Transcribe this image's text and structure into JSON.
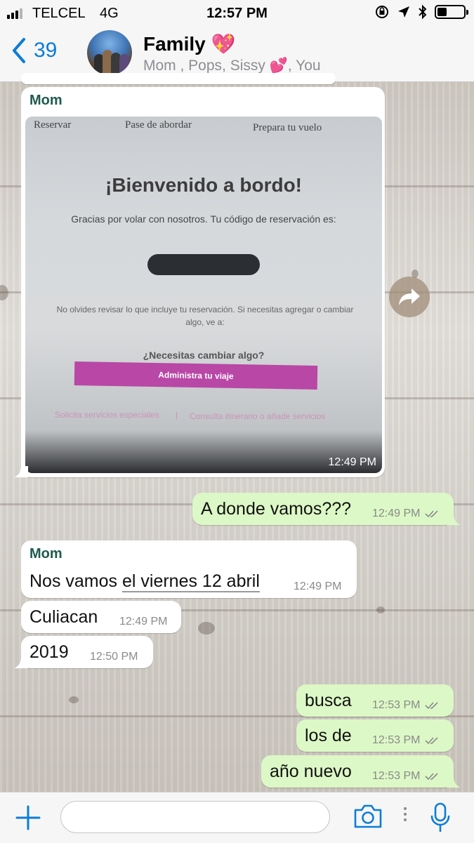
{
  "status_bar": {
    "carrier": "TELCEL",
    "network": "4G",
    "time": "12:57 PM",
    "battery_level": 0.35,
    "icons": [
      "orientation-lock-icon",
      "location-icon",
      "bluetooth-icon",
      "battery-icon"
    ]
  },
  "header": {
    "back_count": "39",
    "title": "Family 💖",
    "subtitle": "Mom , Pops, Sissy 💕, You"
  },
  "messages": {
    "image_msg": {
      "sender": "Mom",
      "time": "12:49 PM",
      "photo": {
        "nav": [
          "Reservar",
          "Pase de abordar",
          "Prepara tu vuelo"
        ],
        "welcome": "¡Bienvenido a bordo!",
        "thanks": "Gracias por volar con nosotros. Tu código de reservación es:",
        "note": "No olvides revisar lo que incluye tu reservación. Si necesitas agregar o cambiar algo, ve a:",
        "need": "¿Necesitas cambiar algo?",
        "cta": "Administra tu viaje",
        "link1": "Solicita servicios especiales",
        "separator": "|",
        "link2": "Consulta itinerario o añade servicios"
      }
    },
    "out1": {
      "text": "A donde vamos???",
      "time": "12:49 PM"
    },
    "mom2": {
      "sender": "Mom",
      "text_pre": "Nos vamos ",
      "text_link": "el viernes 12 abril",
      "time": "12:49 PM"
    },
    "mom3": {
      "text": "Culiacan",
      "time": "12:49 PM"
    },
    "mom4": {
      "text": "2019",
      "time": "12:50 PM"
    },
    "out2": {
      "text": "busca",
      "time": "12:53 PM"
    },
    "out3": {
      "text": "los de",
      "time": "12:53 PM"
    },
    "out4": {
      "text": "año nuevo",
      "time": "12:53 PM"
    }
  },
  "input_bar": {
    "placeholder": ""
  },
  "colors": {
    "accent": "#0b7dd8",
    "outgoing_bubble": "#dcf8c6",
    "incoming_bubble": "#ffffff",
    "sender_name": "#1e5b4c",
    "cta_button": "#b847a6"
  }
}
